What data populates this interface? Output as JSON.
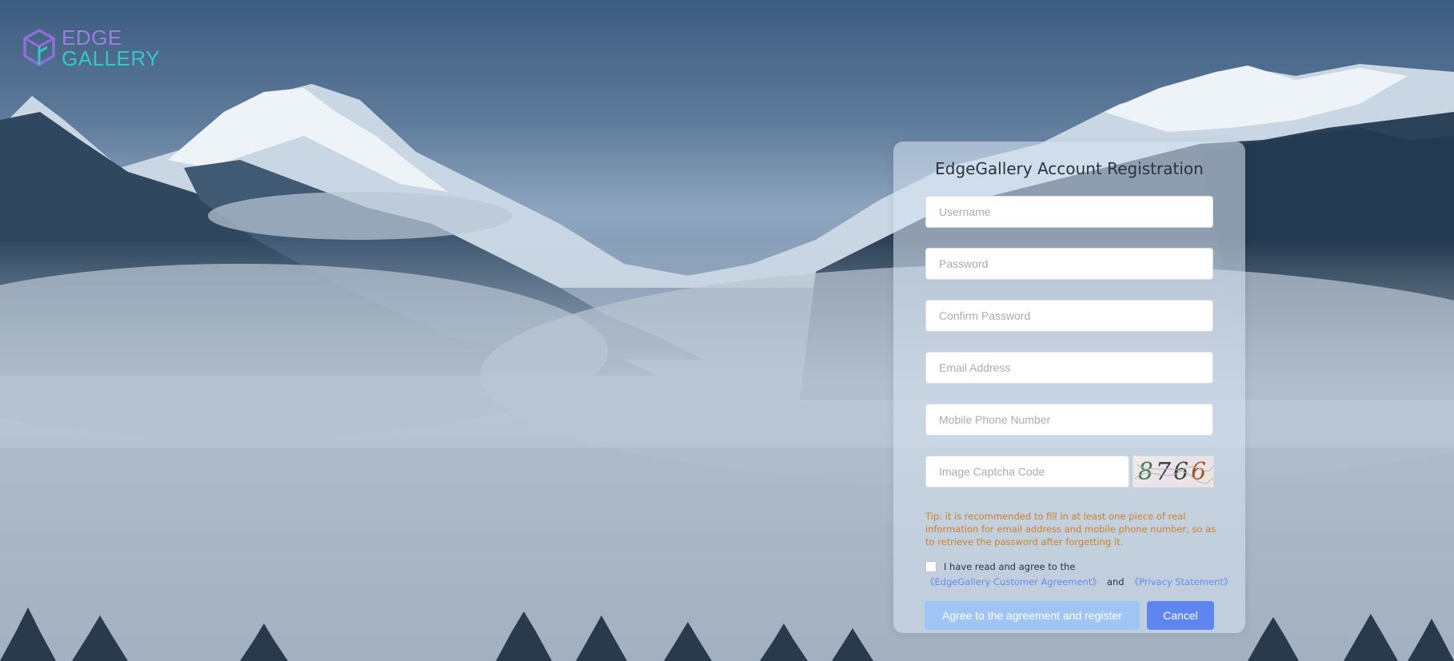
{
  "logo": {
    "line1": "EDGE",
    "line2": "GALLERY",
    "icon": "cube-logo-icon",
    "colors": {
      "line1": "#9b7fe0",
      "line2": "#35c6c7"
    }
  },
  "form": {
    "title": "EdgeGallery Account Registration",
    "username": {
      "placeholder": "Username",
      "value": ""
    },
    "password": {
      "placeholder": "Password",
      "value": ""
    },
    "confirm_password": {
      "placeholder": "Confirm Password",
      "value": ""
    },
    "email": {
      "placeholder": "Email Address",
      "value": ""
    },
    "phone": {
      "placeholder": "Mobile Phone Number",
      "value": ""
    },
    "captcha": {
      "placeholder": "Image Captcha Code",
      "value": "",
      "image_text": "8766"
    },
    "tip": "Tip: it is recommended to fill in at least one piece of real information for email address and mobile phone number, so as to retrieve the password after forgetting it.",
    "agreement": {
      "checked": false,
      "text": "I have read and agree to the",
      "customer_agreement": "《EdgeGallery Customer Agreement》",
      "and": "and",
      "privacy_statement": "《Privacy Statement》"
    },
    "register_button": "Agree to the agreement and register",
    "cancel_button": "Cancel"
  },
  "colors": {
    "tip": "#c8832a",
    "link": "#5f8ef0",
    "register_button": "#a0c5f5",
    "cancel_button": "#5f86f0"
  }
}
